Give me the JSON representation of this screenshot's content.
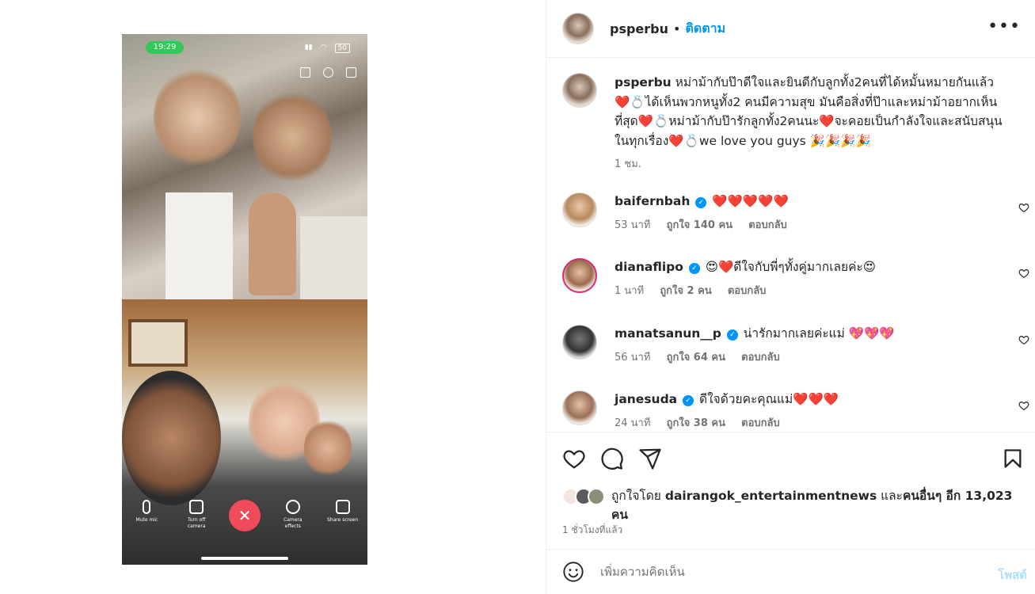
{
  "media": {
    "status_time": "19:29",
    "battery": "50",
    "call_buttons": [
      {
        "label": "Mute mic",
        "icon": "mic-icon"
      },
      {
        "label": "Turn off camera",
        "icon": "camera-icon"
      },
      {
        "label": "",
        "icon": "end-call-icon"
      },
      {
        "label": "Camera effects",
        "icon": "effects-icon"
      },
      {
        "label": "Share screen",
        "icon": "share-screen-icon"
      }
    ]
  },
  "header": {
    "username": "psperbu",
    "separator": "•",
    "follow_label": "ติดตาม",
    "more_icon": "more-options-icon"
  },
  "caption": {
    "username": "psperbu",
    "text": "หม่าม้ากับป๊าดีใจและยินดีกับลูกทั้ง2คนที่ได้หมั้นหมายกันแล้ว ❤️💍ได้เห็นพวกหนูทั้ง2 คนมีความสุข มันคือสิ่งที่ป๊าและหม่าม้าอยากเห็นที่สุด❤️💍หม่าม้ากับป๊ารักลูกทั้ง2คนนะ❤️จะคอยเป็นกำลังใจและสนับสนุนในทุกเรื่อง❤️💍we love you guys 🎉🎉🎉🎉",
    "time": "1 ชม."
  },
  "comments": [
    {
      "username": "baifernbah",
      "verified": true,
      "text": "❤️❤️❤️❤️❤️",
      "time": "53 นาที",
      "likes": "ถูกใจ 140 คน",
      "reply": "ตอบกลับ"
    },
    {
      "username": "dianaflipo",
      "verified": true,
      "text": "😍❤️ดีใจกับพี่ๆทั้งคู่มากเลยค่ะ😍",
      "time": "1 นาที",
      "likes": "ถูกใจ 2 คน",
      "reply": "ตอบกลับ"
    },
    {
      "username": "manatsanun__p",
      "verified": true,
      "text": "น่ารักมากเลยค่ะแม่ 💖💖💖",
      "time": "56 นาที",
      "likes": "ถูกใจ 64 คน",
      "reply": "ตอบกลับ"
    },
    {
      "username": "janesuda",
      "verified": true,
      "text": "ดีใจด้วยคะคุณแม่❤️❤️❤️",
      "time": "24 นาที",
      "likes": "ถูกใจ 38 คน",
      "reply": "ตอบกลับ"
    }
  ],
  "actions": {
    "like_icon": "heart-icon",
    "comment_icon": "comment-icon",
    "share_icon": "send-icon",
    "save_icon": "bookmark-icon"
  },
  "likes": {
    "prefix": "ถูกใจโดย",
    "user": "dairangok_entertainmentnews",
    "joiner": "และ",
    "others": "คนอื่นๆ อีก 13,023 คน"
  },
  "post_time": "1 ชั่วโมงที่แล้ว",
  "add_comment": {
    "placeholder": "เพิ่มความคิดเห็น",
    "post_label": "โพสต์",
    "emoji_icon": "emoji-icon"
  },
  "colors": {
    "accent": "#0095f6",
    "end_call": "#f04b5a",
    "status_pill": "#34c759",
    "heart": "#ed4956"
  }
}
